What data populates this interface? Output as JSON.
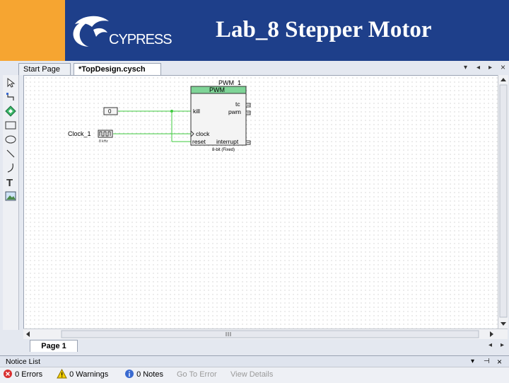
{
  "slide": {
    "title": "Lab_8 Stepper Motor",
    "logo_text": "CYPRESS"
  },
  "tabs": [
    {
      "label": "Start Page"
    },
    {
      "label": "*TopDesign.cysch"
    }
  ],
  "schematic": {
    "component_instance": "PWM_1",
    "component_type": "PWM",
    "pins_left": [
      "kill",
      "clock",
      "reset"
    ],
    "pins_right": [
      "tc",
      "pwm",
      "interrupt"
    ],
    "subtitle": "8-bit (Fixed)",
    "const_value": "0",
    "clock_label": "Clock_1",
    "clock_freq": "8 kHz"
  },
  "page_tab": {
    "label": "Page 1"
  },
  "notice": {
    "label": "Notice List"
  },
  "status": {
    "errors": "0 Errors",
    "warnings": "0 Warnings",
    "notes": "0 Notes",
    "goto": "Go To Error",
    "details": "View Details"
  },
  "colors": {
    "header": "#1e3f8a",
    "accent": "#f6a531",
    "pwm_fill": "#7fd497",
    "wire": "#3ecb3e"
  }
}
